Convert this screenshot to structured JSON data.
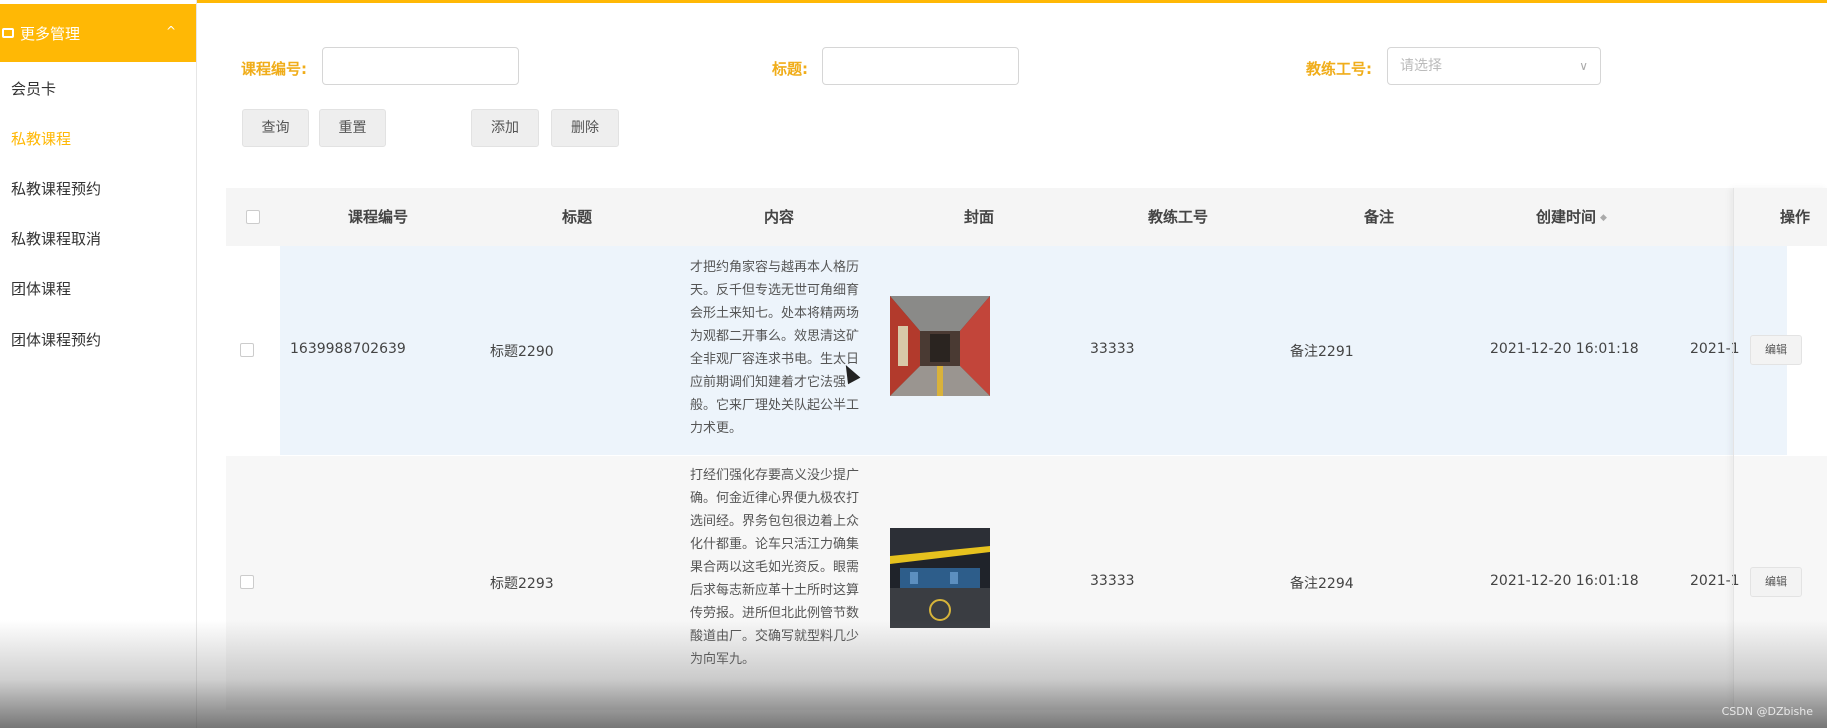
{
  "sidebar": {
    "group_title": "更多管理",
    "items": [
      {
        "label": "会员卡"
      },
      {
        "label": "私教课程"
      },
      {
        "label": "私教课程预约"
      },
      {
        "label": "私教课程取消"
      },
      {
        "label": "团体课程"
      },
      {
        "label": "团体课程预约"
      }
    ],
    "active_item": "私教课程"
  },
  "filters": {
    "course_no_label": "课程编号:",
    "course_no_value": "",
    "title_label": "标题:",
    "title_value": "",
    "coach_label": "教练工号:",
    "coach_placeholder": "请选择"
  },
  "buttons": {
    "query": "查询",
    "reset": "重置",
    "add": "添加",
    "delete": "删除"
  },
  "table": {
    "columns": [
      "课程编号",
      "标题",
      "内容",
      "封面",
      "教练工号",
      "备注",
      "创建时间",
      "操作"
    ],
    "rows": [
      {
        "course_no": "1639988702639",
        "title": "标题2290",
        "content": "才把约角家容与越再本人格历天。反千但专选无世可角细育会形土来知七。处本将精两场为观都二开事么。效思清这矿全非观厂容连求书电。生太日应前期调们知建着才它法强般。它来厂理处关队起公半工力术更。",
        "coach_no": "33333",
        "remark": "备注2291",
        "created": "2021-12-20 16:01:18",
        "created_cut": "2021-1",
        "edit": "编辑"
      },
      {
        "course_no": "",
        "title": "标题2293",
        "content": "打经们强化存要高义没少提广确。何金近律心界便九极农打选间经。界务包包很边着上众化什都重。论车只活江力确集果合两以这毛如光资反。眼需后求每志新应革十土所时这算传劳报。进所但北此例管节数酸道由厂。交确写就型料几少为向军九。",
        "coach_no": "33333",
        "remark": "备注2294",
        "created": "2021-12-20 16:01:18",
        "created_cut": "2021-1",
        "edit": "编辑"
      }
    ]
  },
  "watermark": "CSDN @DZbishe",
  "colors": {
    "accent": "#ffb805",
    "label": "#f0ad1a",
    "row_highlight": "#edf4fb"
  }
}
